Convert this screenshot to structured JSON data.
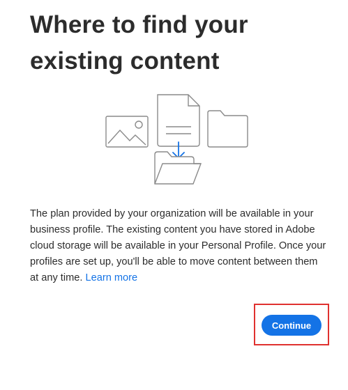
{
  "header": {
    "title": "Where to find your existing content"
  },
  "illustration": {
    "icons": [
      "image-icon",
      "document-icon",
      "download-arrow-icon",
      "folder-icon",
      "open-folder-icon"
    ]
  },
  "body": {
    "paragraph": "The plan provided by your organization will be available in your business profile. The existing content you have stored in Adobe cloud storage will be available in your Personal Profile. Once your profiles are set up, you'll be able to move content between them at any time.",
    "learn_more_label": "Learn more"
  },
  "actions": {
    "continue_label": "Continue"
  },
  "colors": {
    "accent": "#1473e6",
    "highlight_border": "#e0312f",
    "text": "#2c2c2c",
    "illustration_stroke": "#8a8a8a"
  }
}
